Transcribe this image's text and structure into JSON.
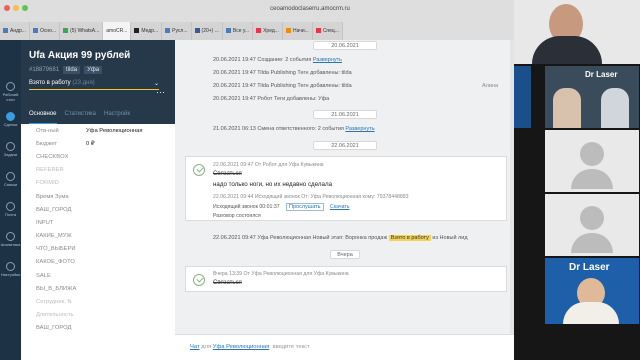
{
  "browser": {
    "address": "ceoamodoclaserru.amocrm.ru",
    "tabs": [
      "Андр...",
      "Осно...",
      "(5) WhatsA...",
      "amoCR...",
      "Медр...",
      "Русл...",
      "(20+) ...",
      "Все у...",
      "Хред...",
      "Начи...",
      "Спец..."
    ]
  },
  "rail": {
    "items": [
      "Рабочий стол",
      "Сделки",
      "Задачи",
      "Списки",
      "Почта",
      "Аналитика",
      "Настройки"
    ]
  },
  "lead": {
    "title": "Ufa Акция 99 рублей",
    "id": "#18879681",
    "tags": [
      "tilda",
      "Уфа"
    ],
    "status": "Взято в работу",
    "status_days": "(23 дня)",
    "more": "···",
    "tabs": [
      "Основное",
      "Статистика",
      "Настройк"
    ]
  },
  "fields": [
    {
      "k": "Отв-ный",
      "v": "Уфа Революционная",
      "dim": false
    },
    {
      "k": "Бюджет",
      "v": "0 ₽",
      "dim": false
    },
    {
      "k": "CHECKBOX",
      "v": "",
      "dim": false
    },
    {
      "k": "REFERER",
      "v": "",
      "dim": true
    },
    {
      "k": "FORMID",
      "v": "",
      "dim": true
    },
    {
      "k": "Время Зума",
      "v": "",
      "dim": false
    },
    {
      "k": "ВАШ_ГОРОД",
      "v": "",
      "dim": false
    },
    {
      "k": "INPUT",
      "v": "",
      "dim": false
    },
    {
      "k": "КАКИЕ_МУЖ",
      "v": "",
      "dim": false
    },
    {
      "k": "ЧТО_ВЫБЕРИ",
      "v": "",
      "dim": false
    },
    {
      "k": "КАКОЕ_ФОТО",
      "v": "",
      "dim": false
    },
    {
      "k": "SALE",
      "v": "",
      "dim": false
    },
    {
      "k": "ВЫ_В_БЛИЖА",
      "v": "",
      "dim": false
    },
    {
      "k": "Сотрудник, N",
      "v": "",
      "dim": true
    },
    {
      "k": "Длительность",
      "v": "",
      "dim": true
    },
    {
      "k": "ВАШ_ГОРОД",
      "v": "",
      "dim": false
    }
  ],
  "feed": {
    "d1": "20.06.2021",
    "e1": "20.06.2021 19:47 Создание: 2 события",
    "e1_link": "Развернуть",
    "e2": "20.06.2021 19:47 Tilda Publishing Тегн добавлены: tilda",
    "e3": "20.06.2021 19:47 Tilda Publishing Тегн добавлены: tilda",
    "e3_right": "Алина",
    "e4": "20.06.2021 19:47 Робот Теги добавлены: Уфа",
    "d2": "21.06.2021",
    "e5": "21.06.2021 06:13 Смена ответственного: 2 события",
    "e5_link": "Развернуть",
    "d3": "22.06.2021",
    "card1": {
      "meta": "22.06.2021 09:47 От Робот для Уфа Кувыкина",
      "strike": "Связаться",
      "text": "надо только ноги, но их недавно сделала",
      "meta2": "22.06.2021 09:44 Исходящий звонок От: Уфа Революционная кому: 79378448883",
      "call": "Исходящий звонок 00:01:37",
      "listen": "Прослушать",
      "download": "Скачать",
      "talk": "Разговор состоялся"
    },
    "e6": "22.06.2021 09:47 Уфа Революционная Новый этап: Воронка продаж",
    "e6_badge": "Взято в работу",
    "e6_tail": "из Новый лид",
    "d4": "Вчера",
    "card2": {
      "meta": "Вчера 13:39 От Уфа Революционная для Уфа Кувыкина",
      "strike": "Связаться"
    },
    "composer_chat": "Чат",
    "composer_mid": "для",
    "composer_user": "Уфа Революционная",
    "composer_tail": ": введите текст"
  },
  "video": {
    "brand": "Dr Laser",
    "brand2": "Dr Laser"
  }
}
